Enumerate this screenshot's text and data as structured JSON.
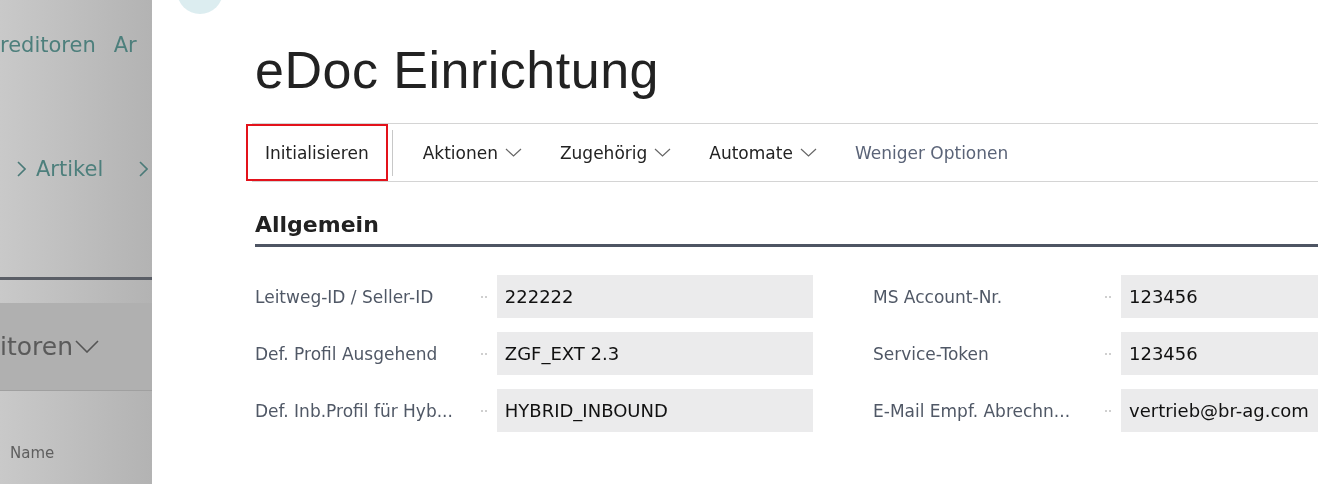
{
  "background_page": {
    "nav_links": [
      "reditoren",
      "Ar"
    ],
    "breadcrumb": [
      "Artikel"
    ],
    "list_title": "itoren",
    "column_header": "Name"
  },
  "dialog": {
    "title": "eDoc Einrichtung",
    "actions": [
      {
        "label": "Initialisieren",
        "kind": "button",
        "highlighted": true
      },
      {
        "label": "Aktionen",
        "kind": "menu",
        "highlighted": false
      },
      {
        "label": "Zugehörig",
        "kind": "menu",
        "highlighted": false
      },
      {
        "label": "Automate",
        "kind": "menu",
        "highlighted": false
      },
      {
        "label": "Weniger Optionen",
        "kind": "toggle",
        "highlighted": false
      }
    ],
    "section": {
      "title": "Allgemein",
      "columns": [
        [
          {
            "label": "Leitweg-ID / Seller-ID",
            "value": "222222"
          },
          {
            "label": "Def. Profil Ausgehend",
            "value": "ZGF_EXT 2.3"
          },
          {
            "label": "Def. Inb.Profil für Hyb...",
            "value": "HYBRID_INBOUND"
          }
        ],
        [
          {
            "label": "MS Account-Nr.",
            "value": "123456"
          },
          {
            "label": "Service-Token",
            "value": "123456"
          },
          {
            "label": "E-Mail Empf. Abrechn...",
            "value": "vertrieb@br-ag.com"
          }
        ]
      ]
    }
  }
}
